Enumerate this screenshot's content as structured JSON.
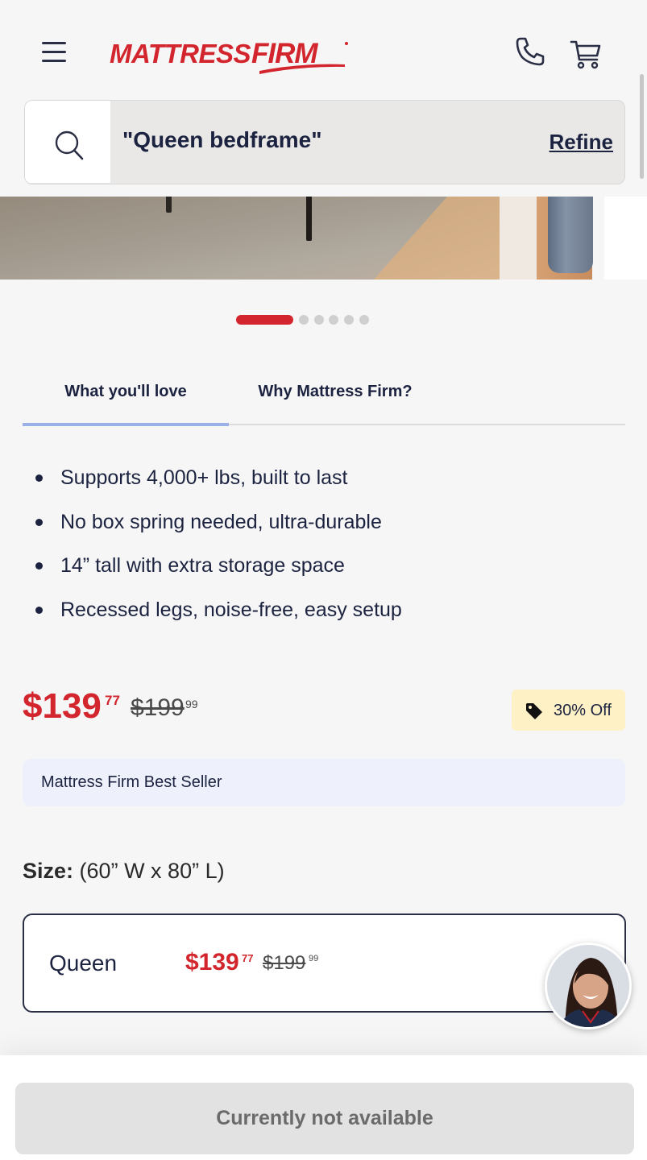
{
  "header": {
    "logo_text": "MATTRESSFIRM",
    "brand_color": "#d3252d",
    "icons": [
      "menu-icon",
      "phone-icon",
      "cart-icon"
    ]
  },
  "search": {
    "query": "\"Queen bedframe\"",
    "refine_label": "Refine"
  },
  "carousel": {
    "total_slides": 6,
    "active_index": 0
  },
  "tabs": [
    {
      "label": "What you'll love",
      "active": true
    },
    {
      "label": "Why Mattress Firm?",
      "active": false
    }
  ],
  "features": [
    "Supports 4,000+ lbs, built to last",
    "No box spring needed, ultra-durable",
    "14” tall with extra storage space",
    "Recessed legs, noise-free, easy setup"
  ],
  "price": {
    "current_main": "$139",
    "current_cents": "77",
    "was_main": "$199",
    "was_cents": "99",
    "discount_badge": "30% Off"
  },
  "best_seller_label": "Mattress Firm Best Seller",
  "size": {
    "label": "Size:",
    "value": "(60” W x 80” L)",
    "options": [
      {
        "name": "Queen",
        "price_main": "$139",
        "price_cents": "77",
        "was_main": "$199",
        "was_cents": "99"
      }
    ]
  },
  "cta": {
    "label": "Currently not available"
  }
}
